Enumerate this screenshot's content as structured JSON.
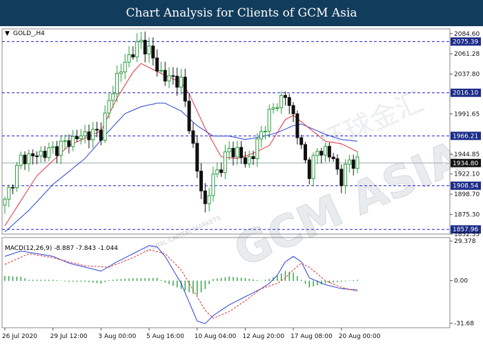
{
  "banner": {
    "title": "Chart Analysis for Clients of GCM Asia"
  },
  "watermark": {
    "text": "GCM ASIA",
    "cn": "环球金汇",
    "sub": "GLOBAL CAPITAL MARKETS"
  },
  "colors": {
    "bull": "#2a9c3c",
    "bear": "#111111",
    "ma_fast": "#e0303a",
    "ma_slow": "#2a3fd8",
    "hline": "#1a1acc",
    "macd_signal": "#e03030",
    "macd_hist": "#2a9c3c",
    "label_bg": "#1b2c8a",
    "last_bg": "#111111",
    "banner_bg": "#123c5c"
  },
  "chart_data": [
    {
      "type": "candlestick",
      "title": "GOLD_,H4",
      "symbol_marker": "▼",
      "ylim": [
        1852.55,
        2090.0
      ],
      "y_ticks": [
        {
          "v": 2084.6,
          "label": "2084.60"
        },
        {
          "v": 2061.28,
          "label": "2061.28"
        },
        {
          "v": 2037.8,
          "label": "2037.80"
        },
        {
          "v": 1991.65,
          "label": "1991.65"
        },
        {
          "v": 1944.85,
          "label": "1944.85"
        },
        {
          "v": 1922.1,
          "label": "1922.10"
        },
        {
          "v": 1898.7,
          "label": "1898.70"
        },
        {
          "v": 1875.3,
          "label": "1875.30"
        },
        {
          "v": 1852.55,
          "label": "1852.55"
        }
      ],
      "levels": [
        {
          "v": 2075.39,
          "label": "2075.39"
        },
        {
          "v": 2016.1,
          "label": "2016.10"
        },
        {
          "v": 1966.21,
          "label": "1966.21"
        },
        {
          "v": 1908.54,
          "label": "1908.54"
        },
        {
          "v": 1857.96,
          "label": "1857.96"
        }
      ],
      "last_price": {
        "v": 1934.8,
        "label": "1934.80"
      },
      "x_labels": [
        "26 Jul 2020",
        "29 Jul 12:00",
        "3 Aug 00:00",
        "5 Aug 16:00",
        "10 Aug 04:00",
        "12 Aug 20:00",
        "17 Aug 08:00",
        "20 Aug 00:00"
      ],
      "x_label_index": [
        0,
        12,
        24,
        36,
        48,
        60,
        72,
        84
      ],
      "close_anchors": [
        [
          0,
          1890
        ],
        [
          4,
          1940
        ],
        [
          8,
          1944
        ],
        [
          12,
          1950
        ],
        [
          16,
          1960
        ],
        [
          20,
          1968
        ],
        [
          24,
          1970
        ],
        [
          26,
          2005
        ],
        [
          28,
          2035
        ],
        [
          30,
          2050
        ],
        [
          32,
          2065
        ],
        [
          34,
          2074
        ],
        [
          36,
          2065
        ],
        [
          38,
          2045
        ],
        [
          40,
          2033
        ],
        [
          42,
          2033
        ],
        [
          44,
          2028
        ],
        [
          46,
          1980
        ],
        [
          48,
          1925
        ],
        [
          50,
          1885
        ],
        [
          52,
          1918
        ],
        [
          54,
          1932
        ],
        [
          56,
          1950
        ],
        [
          58,
          1948
        ],
        [
          60,
          1935
        ],
        [
          62,
          1945
        ],
        [
          64,
          1970
        ],
        [
          66,
          1990
        ],
        [
          68,
          2005
        ],
        [
          70,
          2012
        ],
        [
          72,
          1990
        ],
        [
          74,
          1950
        ],
        [
          76,
          1925
        ],
        [
          78,
          1948
        ],
        [
          80,
          1950
        ],
        [
          82,
          1938
        ],
        [
          84,
          1915
        ],
        [
          86,
          1938
        ],
        [
          88,
          1935
        ]
      ],
      "ma_fast_anchors": [
        [
          0,
          1862
        ],
        [
          8,
          1920
        ],
        [
          16,
          1955
        ],
        [
          24,
          1972
        ],
        [
          28,
          2010
        ],
        [
          32,
          2040
        ],
        [
          34,
          2050
        ],
        [
          40,
          2036
        ],
        [
          44,
          2028
        ],
        [
          46,
          2015
        ],
        [
          50,
          1975
        ],
        [
          54,
          1942
        ],
        [
          58,
          1940
        ],
        [
          62,
          1946
        ],
        [
          66,
          1955
        ],
        [
          70,
          1985
        ],
        [
          72,
          1990
        ],
        [
          76,
          1975
        ],
        [
          80,
          1960
        ],
        [
          84,
          1957
        ],
        [
          88,
          1948
        ]
      ],
      "ma_slow_anchors": [
        [
          0,
          1855
        ],
        [
          6,
          1880
        ],
        [
          12,
          1910
        ],
        [
          20,
          1940
        ],
        [
          26,
          1972
        ],
        [
          30,
          1992
        ],
        [
          34,
          2000
        ],
        [
          38,
          2004
        ],
        [
          40,
          2004
        ],
        [
          44,
          1995
        ],
        [
          48,
          1978
        ],
        [
          52,
          1966
        ],
        [
          56,
          1966
        ],
        [
          60,
          1962
        ],
        [
          64,
          1965
        ],
        [
          68,
          1970
        ],
        [
          72,
          1978
        ],
        [
          74,
          1980
        ],
        [
          80,
          1968
        ],
        [
          84,
          1962
        ],
        [
          88,
          1960
        ]
      ],
      "bar_count": 89
    },
    {
      "type": "macd",
      "title": "MACD(12,26,9) -8.887 -7.843 -1.044",
      "ylim": [
        -35,
        32
      ],
      "y_ticks": [
        {
          "v": 29.378,
          "label": "29.378"
        },
        {
          "v": 0.0,
          "label": "0.00"
        },
        {
          "v": -31.68,
          "label": "-31.68"
        }
      ],
      "macd_anchors": [
        [
          0,
          18
        ],
        [
          4,
          22
        ],
        [
          8,
          20
        ],
        [
          12,
          18
        ],
        [
          16,
          13
        ],
        [
          20,
          10
        ],
        [
          24,
          7
        ],
        [
          28,
          14
        ],
        [
          32,
          20
        ],
        [
          36,
          26
        ],
        [
          38,
          25
        ],
        [
          40,
          18
        ],
        [
          44,
          -2
        ],
        [
          48,
          -30
        ],
        [
          50,
          -32
        ],
        [
          52,
          -26
        ],
        [
          56,
          -18
        ],
        [
          60,
          -12
        ],
        [
          64,
          -6
        ],
        [
          66,
          -2
        ],
        [
          68,
          4
        ],
        [
          70,
          14
        ],
        [
          72,
          18
        ],
        [
          74,
          14
        ],
        [
          76,
          2
        ],
        [
          80,
          -3
        ],
        [
          84,
          -6
        ],
        [
          88,
          -7
        ]
      ],
      "signal_anchors": [
        [
          0,
          12
        ],
        [
          6,
          20
        ],
        [
          12,
          17
        ],
        [
          20,
          11
        ],
        [
          26,
          10
        ],
        [
          32,
          17
        ],
        [
          36,
          23
        ],
        [
          40,
          20
        ],
        [
          44,
          8
        ],
        [
          48,
          -12
        ],
        [
          50,
          -22
        ],
        [
          52,
          -28
        ],
        [
          56,
          -23
        ],
        [
          60,
          -15
        ],
        [
          64,
          -6
        ],
        [
          68,
          -2
        ],
        [
          70,
          2
        ],
        [
          72,
          8
        ],
        [
          74,
          13
        ],
        [
          76,
          10
        ],
        [
          80,
          0
        ],
        [
          84,
          -5
        ],
        [
          88,
          -8
        ]
      ]
    }
  ]
}
